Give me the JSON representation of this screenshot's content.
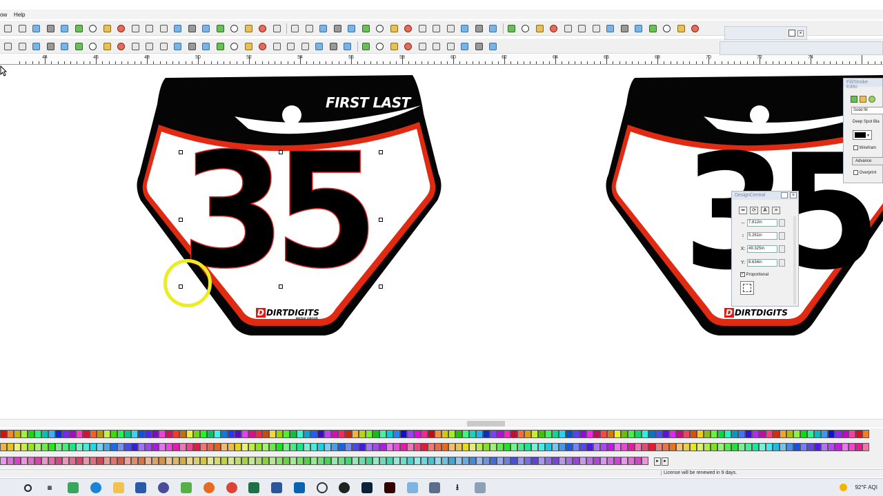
{
  "menu": {
    "partial_left": "ow",
    "help": "Help"
  },
  "ruler": {
    "labels": [
      "44",
      "46",
      "48",
      "50",
      "52",
      "54",
      "56",
      "58",
      "60",
      "62",
      "64",
      "66",
      "68",
      "70",
      "72",
      "74"
    ]
  },
  "plate_left": {
    "name": "FIRST LAST",
    "number": "35",
    "brand": "DIRTDIGITS",
    "brand_mark": "D",
    "brand_sub": "MEDIA GROUP"
  },
  "plate_right": {
    "number": "35",
    "brand": "DIRTDIGITS",
    "brand_mark": "D"
  },
  "fill_stroke_editor": {
    "title": "Fill/Stroke Edito",
    "fill_mode": "Solid fill",
    "color_name": "Deep Spot Bla",
    "wireframe_label": "Wirefram",
    "advanced_label": "Advance",
    "overprint_label": "Overprint"
  },
  "design_central": {
    "title": "DesignCentral",
    "width_value": "7.812in",
    "height_value": "5.261in",
    "x_label": "X:",
    "x_value": "49.325in",
    "y_label": "Y:",
    "y_value": "8.634in",
    "proportional_label": "Proportional",
    "proportional_checked": "✓"
  },
  "status": {
    "message": "License will be renewed in 9 days."
  },
  "tray": {
    "temperature": "92°F",
    "aqi": "AQI"
  },
  "colors": {
    "stroke_red": "#e02a12",
    "plate_black": "#050505",
    "selection_red": "#d22222",
    "highlight_yellow": "#ecec22"
  }
}
